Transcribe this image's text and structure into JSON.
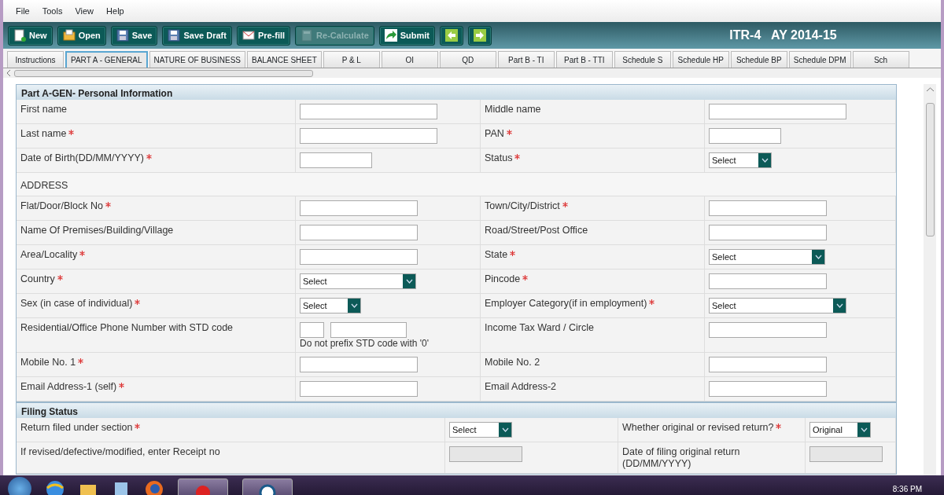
{
  "menu": [
    "File",
    "Tools",
    "View",
    "Help"
  ],
  "toolbar": [
    {
      "label": "New",
      "disabled": false
    },
    {
      "label": "Open",
      "disabled": false
    },
    {
      "label": "Save",
      "disabled": false
    },
    {
      "label": "Save Draft",
      "disabled": false
    },
    {
      "label": "Pre-fill",
      "disabled": false
    },
    {
      "label": "Re-Calculate",
      "disabled": true
    },
    {
      "label": "Submit",
      "disabled": false
    },
    {
      "disabled": false
    },
    {
      "disabled": false
    }
  ],
  "form_title": "ITR-4   AY 2014-15",
  "tabs": [
    {
      "label": "Instructions",
      "selected": false
    },
    {
      "label": "PART A - GENERAL",
      "selected": true
    },
    {
      "label": "NATURE OF BUSINESS",
      "selected": false
    },
    {
      "label": "BALANCE SHEET",
      "selected": false
    },
    {
      "label": "P & L",
      "selected": false
    },
    {
      "label": "OI",
      "selected": false
    },
    {
      "label": "QD",
      "selected": false
    },
    {
      "label": "Part B - TI",
      "selected": false
    },
    {
      "label": "Part B - TTI",
      "selected": false
    },
    {
      "label": "Schedule S",
      "selected": false
    },
    {
      "label": "Schedule HP",
      "selected": false
    },
    {
      "label": "Schedule BP",
      "selected": false
    },
    {
      "label": "Schedule DPM",
      "selected": false
    },
    {
      "label": "Sch",
      "selected": false
    }
  ],
  "sections": [
    {
      "title": "Part A-GEN- Personal Information",
      "rows": [
        {
          "kind": "pair",
          "items": [
            {
              "label": "First name",
              "field": {
                "kind": "text"
              }
            },
            {
              "label": "Middle name",
              "field": {
                "kind": "text"
              }
            }
          ]
        },
        {
          "kind": "pair",
          "items": [
            {
              "label": "Last name",
              "required": true,
              "field": {
                "kind": "text"
              }
            },
            {
              "label": "PAN",
              "required": true,
              "field": {
                "kind": "text"
              }
            }
          ]
        },
        {
          "kind": "pair",
          "items": [
            {
              "label": "Date of Birth(DD/MM/YYYY)",
              "required": true,
              "field": {
                "kind": "text"
              }
            },
            {
              "label": "Status",
              "required": true,
              "field": {
                "kind": "select",
                "value": "Select"
              }
            }
          ]
        },
        {
          "kind": "heading",
          "label": "ADDRESS"
        },
        {
          "kind": "pair",
          "items": [
            {
              "label": "Flat/Door/Block No",
              "required": true,
              "field": {
                "kind": "text"
              }
            },
            {
              "label": "Town/City/District",
              "required": true,
              "field": {
                "kind": "text"
              }
            }
          ]
        },
        {
          "kind": "pair",
          "items": [
            {
              "label": "Name Of Premises/Building/Village",
              "field": {
                "kind": "text"
              }
            },
            {
              "label": "Road/Street/Post Office",
              "field": {
                "kind": "text"
              }
            }
          ]
        },
        {
          "kind": "pair",
          "items": [
            {
              "label": "Area/Locality",
              "required": true,
              "field": {
                "kind": "text"
              }
            },
            {
              "label": "State",
              "required": true,
              "field": {
                "kind": "select",
                "value": "Select"
              }
            }
          ]
        },
        {
          "kind": "pair",
          "items": [
            {
              "label": "Country",
              "required": true,
              "field": {
                "kind": "select",
                "value": "Select"
              }
            },
            {
              "label": "Pincode",
              "required": true,
              "field": {
                "kind": "text"
              }
            }
          ]
        },
        {
          "kind": "pair",
          "items": [
            {
              "label": "Sex (in case of individual)",
              "required": true,
              "field": {
                "kind": "select",
                "value": "Select"
              }
            },
            {
              "label": "Employer Category(if in employment)",
              "required": true,
              "field": {
                "kind": "select",
                "value": "Select"
              }
            }
          ]
        },
        {
          "kind": "pair",
          "items": [
            {
              "label": "Residential/Office Phone Number with STD code",
              "field": {
                "kind": "phone",
                "note": "Do not prefix STD code with '0'"
              }
            },
            {
              "label": "Income Tax Ward / Circle",
              "field": {
                "kind": "text"
              }
            }
          ]
        },
        {
          "kind": "pair",
          "items": [
            {
              "label": "Mobile No. 1",
              "required": true,
              "field": {
                "kind": "text"
              }
            },
            {
              "label": "Mobile No. 2",
              "field": {
                "kind": "text"
              }
            }
          ]
        },
        {
          "kind": "pair",
          "items": [
            {
              "label": "Email Address-1 (self)",
              "required": true,
              "field": {
                "kind": "text"
              }
            },
            {
              "label": "Email Address-2",
              "field": {
                "kind": "text"
              }
            }
          ]
        }
      ]
    },
    {
      "title": "Filing Status",
      "rows": [
        {
          "kind": "pair",
          "items": [
            {
              "label": "Return filed under section",
              "required": true,
              "field": {
                "kind": "select",
                "value": "Select"
              }
            },
            {
              "label": "Whether original or revised return?",
              "required": true,
              "field": {
                "kind": "select",
                "value": "Original"
              }
            }
          ]
        },
        {
          "kind": "pair",
          "items": [
            {
              "label": "If revised/defective/modified, enter Receipt no",
              "field": {
                "kind": "readonly"
              }
            },
            {
              "label": "Date of filing original return (DD/MM/YYYY)",
              "field": {
                "kind": "readonly"
              }
            }
          ]
        }
      ]
    }
  ],
  "clock": "8:36 PM"
}
